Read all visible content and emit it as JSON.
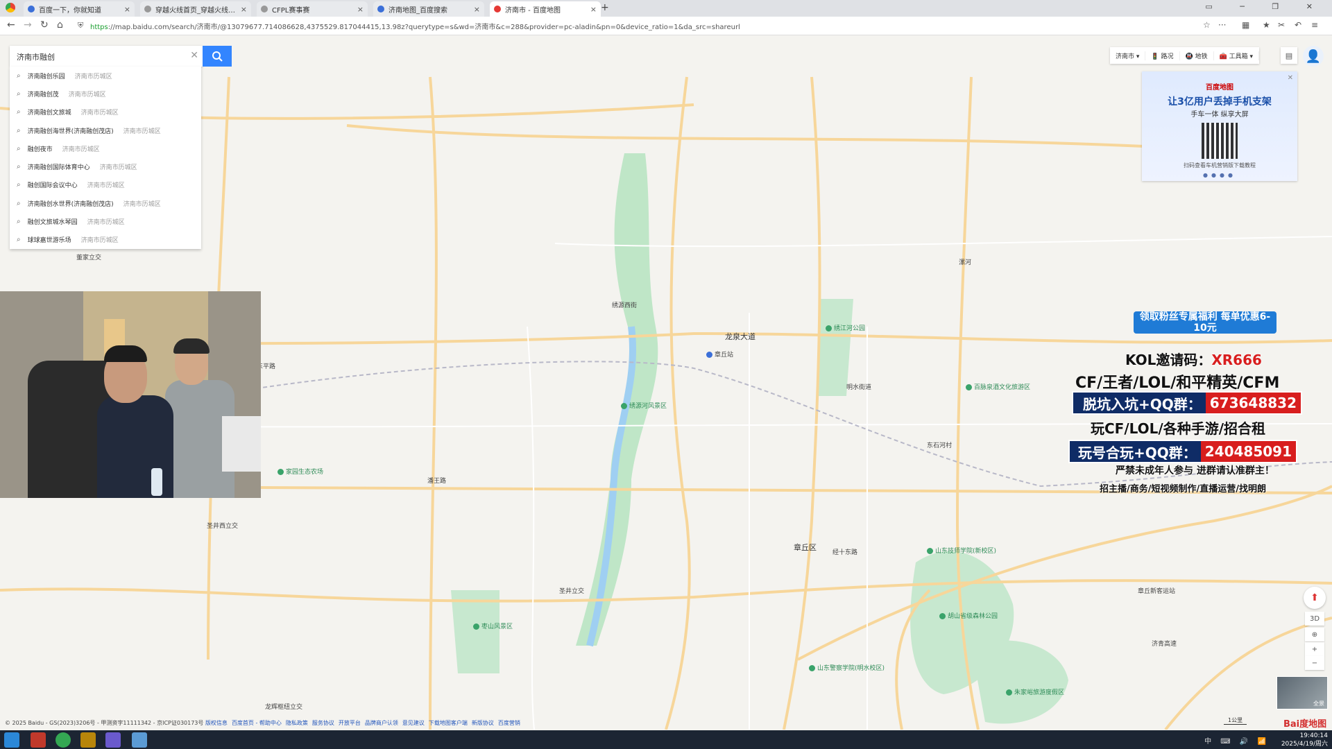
{
  "browser": {
    "tabs": [
      {
        "title": "百度一下，你就知道",
        "color": "#3b6fd8",
        "active": false
      },
      {
        "title": "穿越火线首页_穿越火线首页",
        "color": "#999999",
        "active": false
      },
      {
        "title": "CFPL赛事赛",
        "color": "#999999",
        "active": false
      },
      {
        "title": "济南地图_百度搜索",
        "color": "#3b6fd8",
        "active": false
      },
      {
        "title": "济南市 - 百度地图",
        "color": "#e53935",
        "active": true
      }
    ],
    "new_tab": "+",
    "close_glyph": "×",
    "url_proto": "https",
    "url_rest": "://map.baidu.com/search/济南市/@13079677.714086628,4375529.817044415,13.98z?querytype=s&wd=济南市&c=288&provider=pc-aladin&pn=0&device_ratio=1&da_src=shareurl"
  },
  "search": {
    "value": "济南市融创",
    "suggestions": [
      {
        "name": "济南融创乐园",
        "area": "济南市历城区"
      },
      {
        "name": "济南融创茂",
        "area": "济南市历城区"
      },
      {
        "name": "济南融创文旅城",
        "area": "济南市历城区"
      },
      {
        "name": "济南融创海世界(济南融创茂店)",
        "area": "济南市历城区"
      },
      {
        "name": "融创夜市",
        "area": "济南市历城区"
      },
      {
        "name": "济南融创国际体育中心",
        "area": "济南市历城区"
      },
      {
        "name": "融创国际会议中心",
        "area": "济南市历城区"
      },
      {
        "name": "济南融创水世界(济南融创茂店)",
        "area": "济南市历城区"
      },
      {
        "name": "融创文旅城水琴园",
        "area": "济南市历城区"
      },
      {
        "name": "球球嘉世游乐场",
        "area": "济南市历城区"
      }
    ]
  },
  "controls": {
    "city": "济南市",
    "items": [
      "路况",
      "地铁",
      "工具箱"
    ]
  },
  "ad": {
    "brand": "百度地图",
    "headline": "让3亿用户丢掉手机支架",
    "sub": "手车一体 纵享大屏",
    "caption": "扫码查看车机营销版下载教程",
    "dots": "●●●●"
  },
  "map_labels": [
    {
      "text": "龙泉大道"
    },
    {
      "text": "章丘站"
    },
    {
      "text": "绣江河公园"
    },
    {
      "text": "明水街道"
    },
    {
      "text": "百脉泉酒文化旅游区"
    },
    {
      "text": "东石河村"
    },
    {
      "text": "绣源河风景区"
    },
    {
      "text": "章丘区"
    },
    {
      "text": "经十东路"
    },
    {
      "text": "山东技师学院(新校区)"
    },
    {
      "text": "章丘新客运站"
    },
    {
      "text": "胡山省级森林公园"
    },
    {
      "text": "山东警察学院(明水校区)"
    },
    {
      "text": "朱家峪旅游度假区"
    },
    {
      "text": "枣山风景区"
    },
    {
      "text": "圣井立交"
    },
    {
      "text": "圣井西立交"
    },
    {
      "text": "龙辉枢纽立交"
    },
    {
      "text": "董家立交"
    },
    {
      "text": "济青高速"
    },
    {
      "text": "绣源西街"
    },
    {
      "text": "潘王路"
    },
    {
      "text": "漯河"
    },
    {
      "text": "家园生态农场"
    },
    {
      "text": "东平路"
    }
  ],
  "overlay": {
    "promo": "领取粉丝专属福利 每单优惠6-10元",
    "kol_label": "KOL邀请码：",
    "kol_code": "XR666",
    "games": "CF/王者/LOL/和平精英/CFM",
    "qq1_label": "脱坑入坑+QQ群：",
    "qq1_num": "673648832",
    "games2": "玩CF/LOL/各种手游/招合租",
    "qq2_label": "玩号合玩+QQ群：",
    "qq2_num": "240485091",
    "warn": "严禁未成年人参与  进群请认准群主！",
    "recruit": "招主播/商务/短视频制作/直播运营/找明朗"
  },
  "map_tools": {
    "threeD": "3D",
    "locate": "⊕",
    "zoom_in": "+",
    "zoom_out": "−",
    "panorama": "全景",
    "scale": "1公里",
    "logo": "Bai度地图"
  },
  "footer": {
    "copyright": "© 2025 Baidu - GS(2023)3206号 - 甲测资字11111342 - 京ICP证030173号",
    "links": [
      "版权信息",
      "百度首页 - 帮助中心",
      "隐私政策",
      "服务协议",
      "开放平台",
      "品牌商户认领",
      "意见建议",
      "下载地图客户端",
      "新版协议",
      "百度营销"
    ]
  },
  "taskbar": {
    "time": "19:40:14",
    "date": "2025/4/19/周六",
    "tray": "中 ⌨ 🔊 📶"
  }
}
